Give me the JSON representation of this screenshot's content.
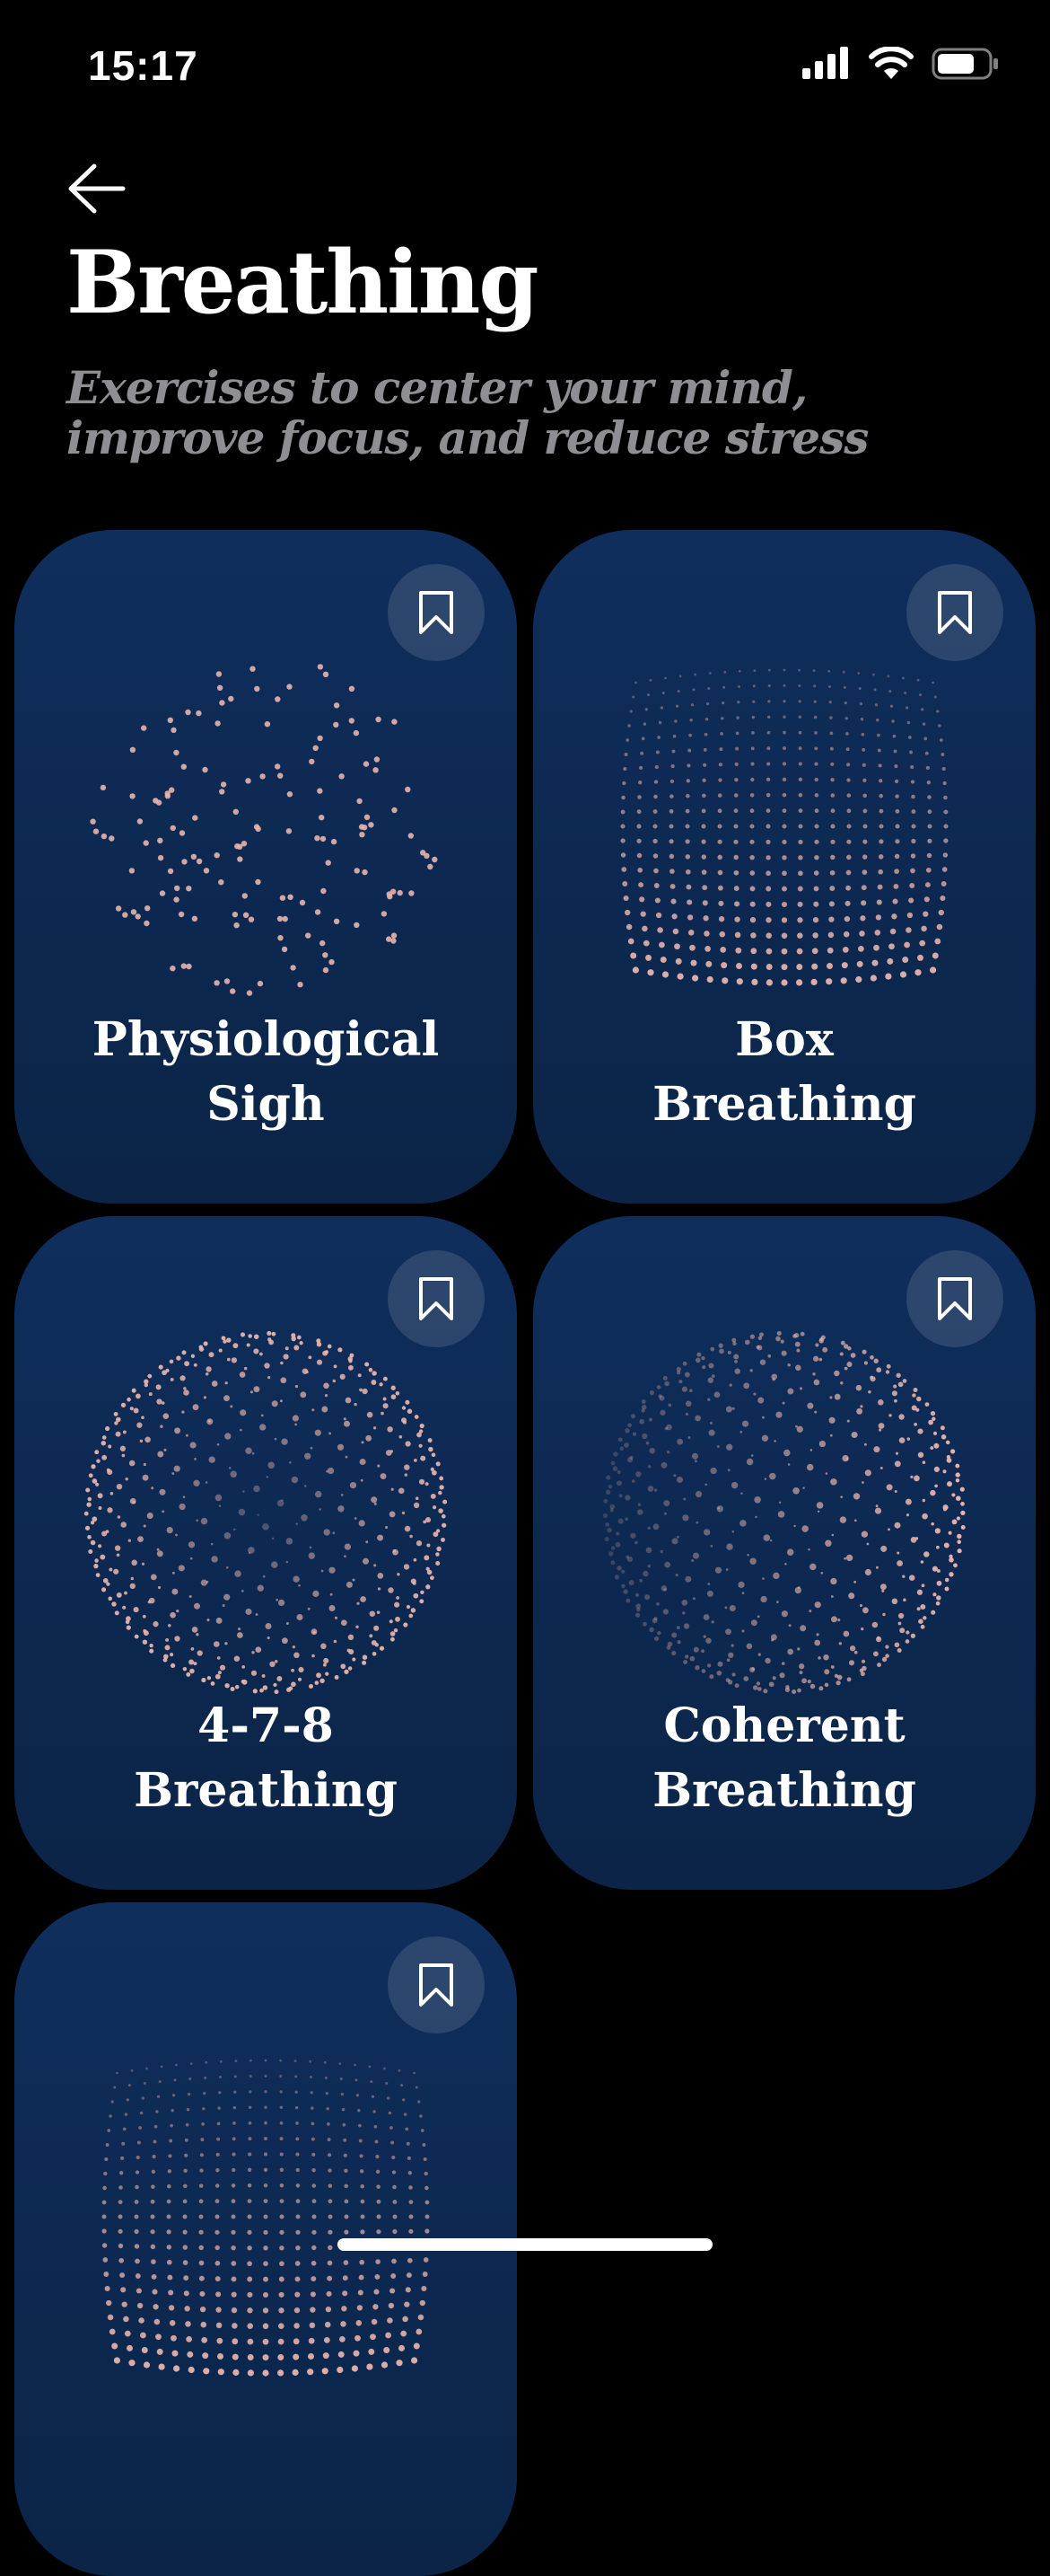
{
  "status_bar": {
    "time": "15:17",
    "icons": [
      "signal-icon",
      "wifi-icon",
      "battery-icon"
    ]
  },
  "header": {
    "back_icon": "arrow-left-icon",
    "title": "Breathing",
    "subtitle": "Exercises to center your mind, improve focus, and reduce stress"
  },
  "cards": [
    {
      "title_line1": "Physiological",
      "title_line2": "Sigh",
      "pattern": "scatter",
      "bookmark_icon": "bookmark-icon"
    },
    {
      "title_line1": "Box",
      "title_line2": "Breathing",
      "pattern": "grid",
      "bookmark_icon": "bookmark-icon"
    },
    {
      "title_line1": "4-7-8",
      "title_line2": "Breathing",
      "pattern": "sphere",
      "bookmark_icon": "bookmark-icon"
    },
    {
      "title_line1": "Coherent",
      "title_line2": "Breathing",
      "pattern": "sphere-side",
      "bookmark_icon": "bookmark-icon"
    },
    {
      "title_line1": "",
      "title_line2": "",
      "pattern": "grid",
      "bookmark_icon": "bookmark-icon"
    }
  ],
  "colors": {
    "background": "#000000",
    "card": "#0f2e5c",
    "dots": "#e8b4ad",
    "subtitle": "#8e8e93"
  }
}
